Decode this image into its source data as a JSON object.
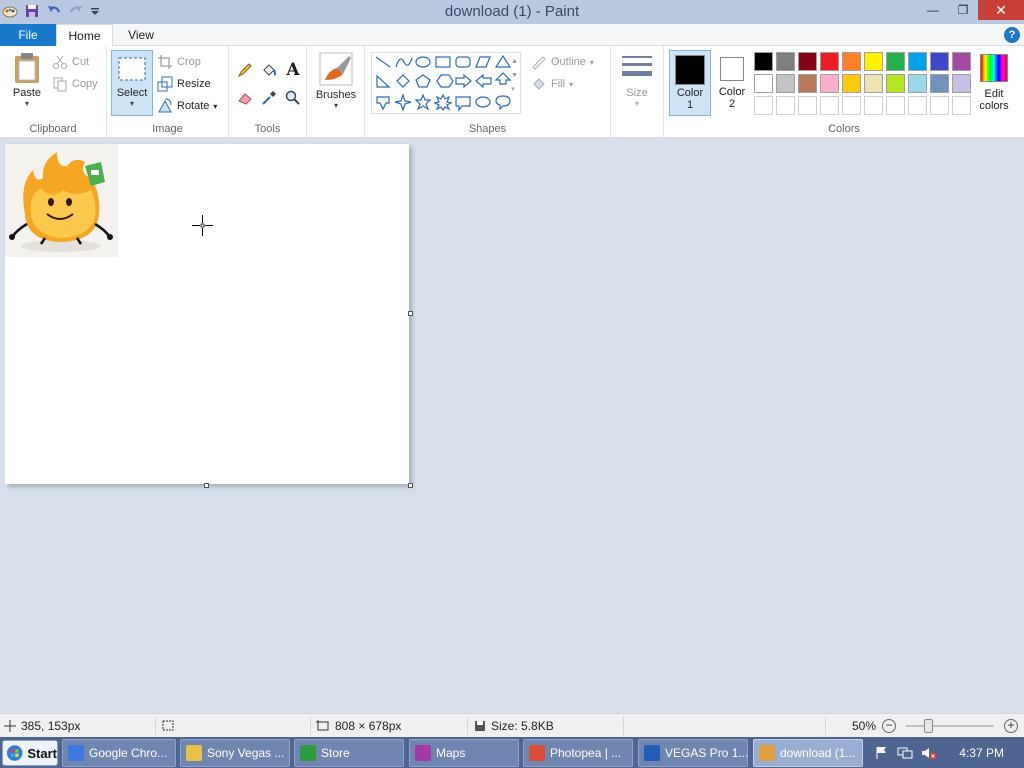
{
  "window": {
    "title": "download (1) - Paint",
    "minimize_glyph": "—",
    "restore_glyph": "❐",
    "close_glyph": "✕"
  },
  "tabs": {
    "file": "File",
    "home": "Home",
    "view": "View",
    "help_glyph": "?"
  },
  "clipboard": {
    "paste": "Paste",
    "cut": "Cut",
    "copy": "Copy",
    "group_label": "Clipboard"
  },
  "image": {
    "select": "Select",
    "crop": "Crop",
    "resize": "Resize",
    "rotate": "Rotate",
    "group_label": "Image"
  },
  "tools": {
    "text_tool_glyph": "A",
    "group_label": "Tools"
  },
  "brushes": {
    "label": "Brushes"
  },
  "shapes": {
    "outline": "Outline",
    "fill": "Fill",
    "group_label": "Shapes"
  },
  "size": {
    "label": "Size"
  },
  "colors": {
    "color1_label": "Color 1",
    "color1_line1": "Color",
    "color1_line2": "1",
    "color1_value": "#000000",
    "color2_line1": "Color",
    "color2_line2": "2",
    "color2_value": "#ffffff",
    "edit_line1": "Edit",
    "edit_line2": "colors",
    "group_label": "Colors",
    "palette_row1": [
      "#000000",
      "#7f7f7f",
      "#880015",
      "#ed1c24",
      "#ff7f27",
      "#fff200",
      "#22b14c",
      "#00a2e8",
      "#3f48cc",
      "#a349a4"
    ],
    "palette_row2": [
      "#ffffff",
      "#c3c3c3",
      "#b97a57",
      "#ffaec9",
      "#ffc90e",
      "#efe4b0",
      "#b5e61d",
      "#99d9ea",
      "#7092be",
      "#c8bfe7"
    ],
    "palette_row3": [
      "#ffffff",
      "#ffffff",
      "#ffffff",
      "#ffffff",
      "#ffffff",
      "#ffffff",
      "#ffffff",
      "#ffffff",
      "#ffffff",
      "#ffffff"
    ]
  },
  "status": {
    "cursor_pos": "385, 153px",
    "image_size": "808 × 678px",
    "file_size": "Size: 5.8KB",
    "zoom": "50%",
    "zoom_out_glyph": "−",
    "zoom_in_glyph": "+"
  },
  "taskbar": {
    "start": "Start",
    "items": [
      {
        "label": "Google Chro...",
        "color": "#3b7be0"
      },
      {
        "label": "Sony Vegas ...",
        "color": "#e8c04a"
      },
      {
        "label": "Store",
        "color": "#2d9a3d"
      },
      {
        "label": "Maps",
        "color": "#a33aa8"
      },
      {
        "label": "Photopea | ...",
        "color": "#dd4b39"
      },
      {
        "label": "VEGAS Pro 1...",
        "color": "#1f5fb8"
      },
      {
        "label": "download (1...",
        "color": "#e0a040"
      }
    ],
    "clock": "4:37 PM"
  }
}
